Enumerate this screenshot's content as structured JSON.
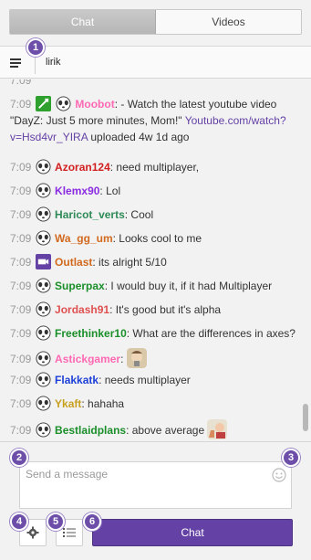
{
  "tabs": [
    {
      "label": "Chat",
      "active": true
    },
    {
      "label": "Videos",
      "active": false
    }
  ],
  "header": {
    "channel": "lirik"
  },
  "step_badges": [
    "1",
    "2",
    "3",
    "4",
    "5",
    "6"
  ],
  "messages": [
    {
      "time": "7:09",
      "badges": [
        "turbo-icon",
        "panda-icon"
      ],
      "user": "Moobot",
      "user_color": "#ff69b4",
      "text": ": - Watch the latest youtube video \"DayZ: Just 5 more minutes, Mom!\" ",
      "link": "Youtube.com/watch?v=Hsd4vr_YIRA",
      "text_after": " uploaded 4w 1d ago"
    },
    {
      "time": "7:09",
      "badges": [
        "panda-icon"
      ],
      "user": "Azoran124",
      "user_color": "#d21f1f",
      "text": ": need multiplayer,"
    },
    {
      "time": "7:09",
      "badges": [
        "panda-icon"
      ],
      "user": "Klemx90",
      "user_color": "#8a2be2",
      "text": ": Lol"
    },
    {
      "time": "7:09",
      "badges": [
        "panda-icon"
      ],
      "user": "Haricot_verts",
      "user_color": "#2e8b57",
      "text": ": Cool"
    },
    {
      "time": "7:09",
      "badges": [
        "panda-icon"
      ],
      "user": "Wa_gg_um",
      "user_color": "#d2691e",
      "text": ": Looks cool to me"
    },
    {
      "time": "7:09",
      "badges": [
        "turbo-purple-icon"
      ],
      "user": "Outlast",
      "user_color": "#d2691e",
      "text": ": its alright 5/10"
    },
    {
      "time": "7:09",
      "badges": [
        "panda-icon"
      ],
      "user": "Superpax",
      "user_color": "#1a8f2a",
      "text": ": I would buy it, if it had Multiplayer"
    },
    {
      "time": "7:09",
      "badges": [
        "panda-icon"
      ],
      "user": "Jordash91",
      "user_color": "#e05050",
      "text": ": It's good but it's alpha"
    },
    {
      "time": "7:09",
      "badges": [
        "panda-icon"
      ],
      "user": "Freethinker10",
      "user_color": "#1a8f2a",
      "text": ": What are the differences in axes?"
    },
    {
      "time": "7:09",
      "badges": [
        "panda-icon"
      ],
      "user": "Astickgamer",
      "user_color": "#ff69b4",
      "text": ":",
      "emote": "face-emote"
    },
    {
      "time": "7:09",
      "badges": [
        "panda-icon"
      ],
      "user": "Flakkatk",
      "user_color": "#1e40d8",
      "text": ": needs multiplayer"
    },
    {
      "time": "7:09",
      "badges": [
        "panda-icon"
      ],
      "user": "Ykaft",
      "user_color": "#c8a020",
      "text": ": hahaha"
    },
    {
      "time": "7:09",
      "badges": [
        "panda-icon"
      ],
      "user": "Bestlaidplans",
      "user_color": "#1a8f2a",
      "text": ": above average",
      "emote": "thumbs-up-emote"
    }
  ],
  "input": {
    "placeholder": "Send a message"
  },
  "buttons": {
    "chat_label": "Chat"
  },
  "colors": {
    "accent": "#6441a5",
    "badge": "#6d4ea8"
  }
}
